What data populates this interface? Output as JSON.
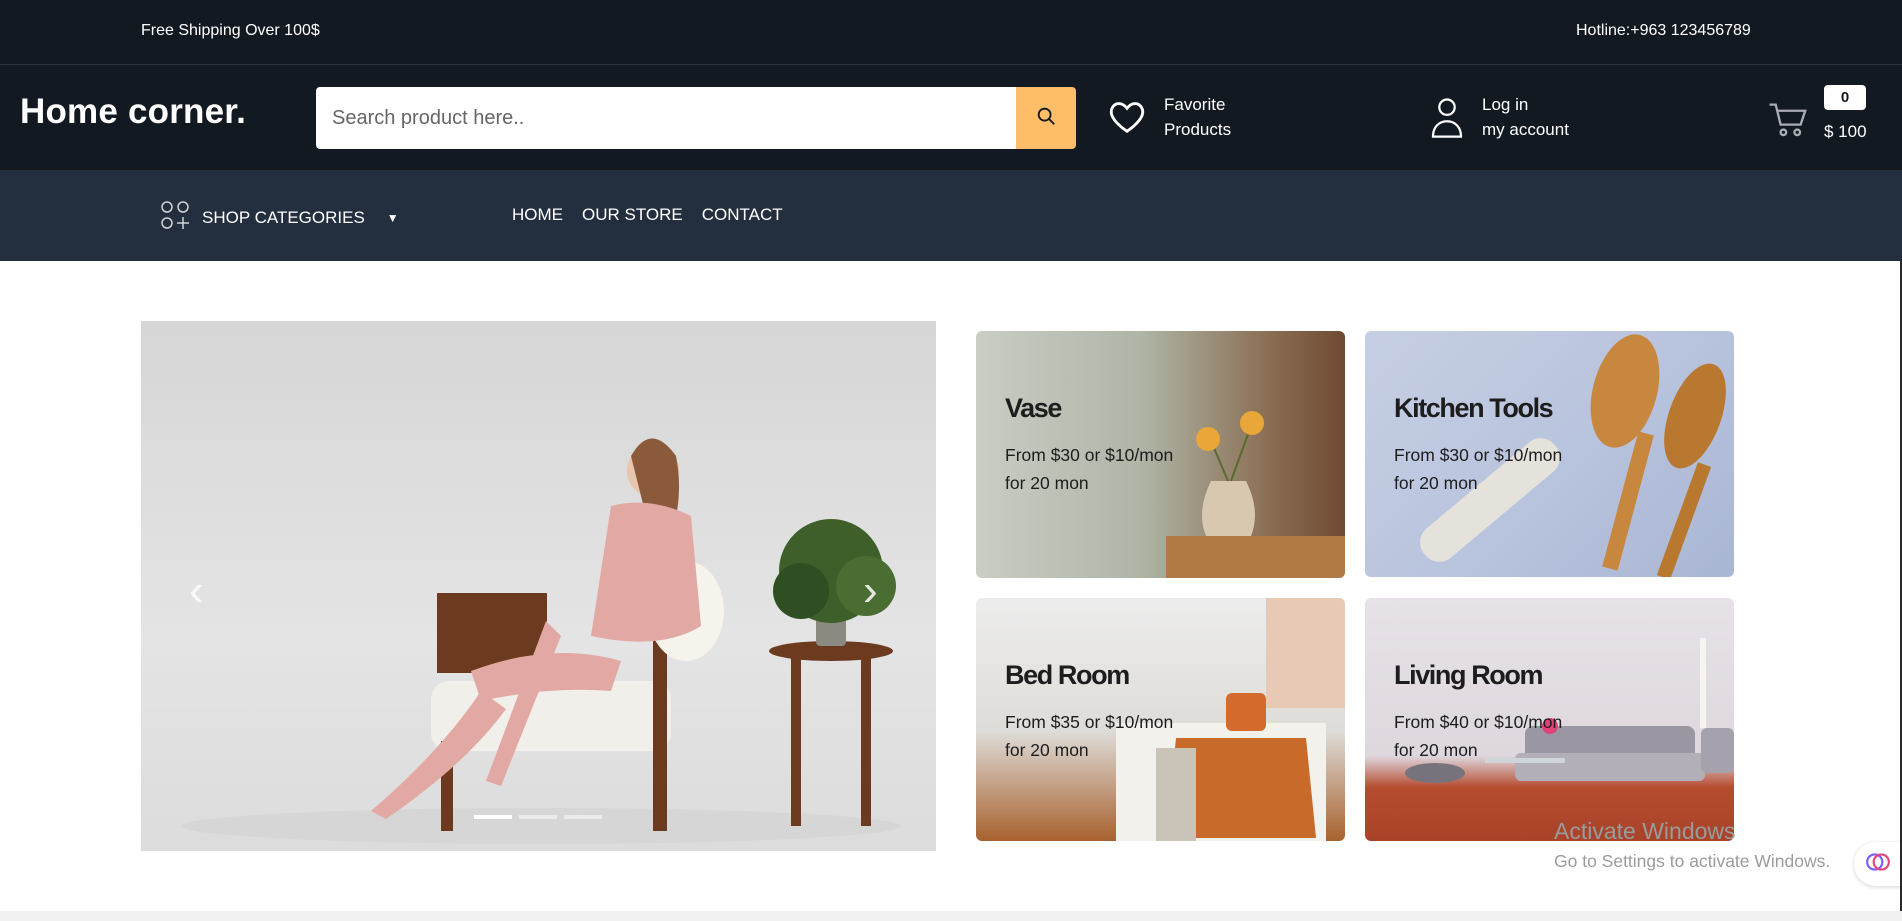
{
  "topbar": {
    "shipping": "Free Shipping Over 100$",
    "hotline": "Hotline:+963 123456789"
  },
  "header": {
    "logo": "Home corner.",
    "search_placeholder": "Search product here..",
    "favorite_line1": "Favorite",
    "favorite_line2": "Products",
    "login_line1": "Log in",
    "login_line2": "my account",
    "cart_count": "0",
    "cart_total": "$ 100"
  },
  "nav": {
    "categories_label": "SHOP CATEGORIES",
    "items": [
      "HOME",
      "OUR STORE",
      "CONTACT"
    ]
  },
  "hero": {
    "slides": 3,
    "active_slide": 1
  },
  "cards": [
    {
      "title": "Vase",
      "line1": "From $30 or $10/mon",
      "line2": "for 20 mon"
    },
    {
      "title": "Kitchen Tools",
      "line1": "From $30 or $10/mon",
      "line2": "for 20 mon"
    },
    {
      "title": "Bed Room",
      "line1": "From $35 or $10/mon",
      "line2": "for 20 mon"
    },
    {
      "title": "Living Room",
      "line1": "From $40 or $10/mon",
      "line2": "for 20 mon"
    }
  ],
  "watermark": {
    "line1": "Activate Windows",
    "line2": "Go to Settings to activate Windows."
  },
  "colors": {
    "header_bg": "#131921",
    "nav_bg": "#232f3e",
    "accent": "#febd69"
  },
  "icons": [
    "heart-icon",
    "user-icon",
    "cart-icon",
    "search-icon",
    "categories-icon",
    "chevron-left-icon",
    "chevron-right-icon"
  ]
}
